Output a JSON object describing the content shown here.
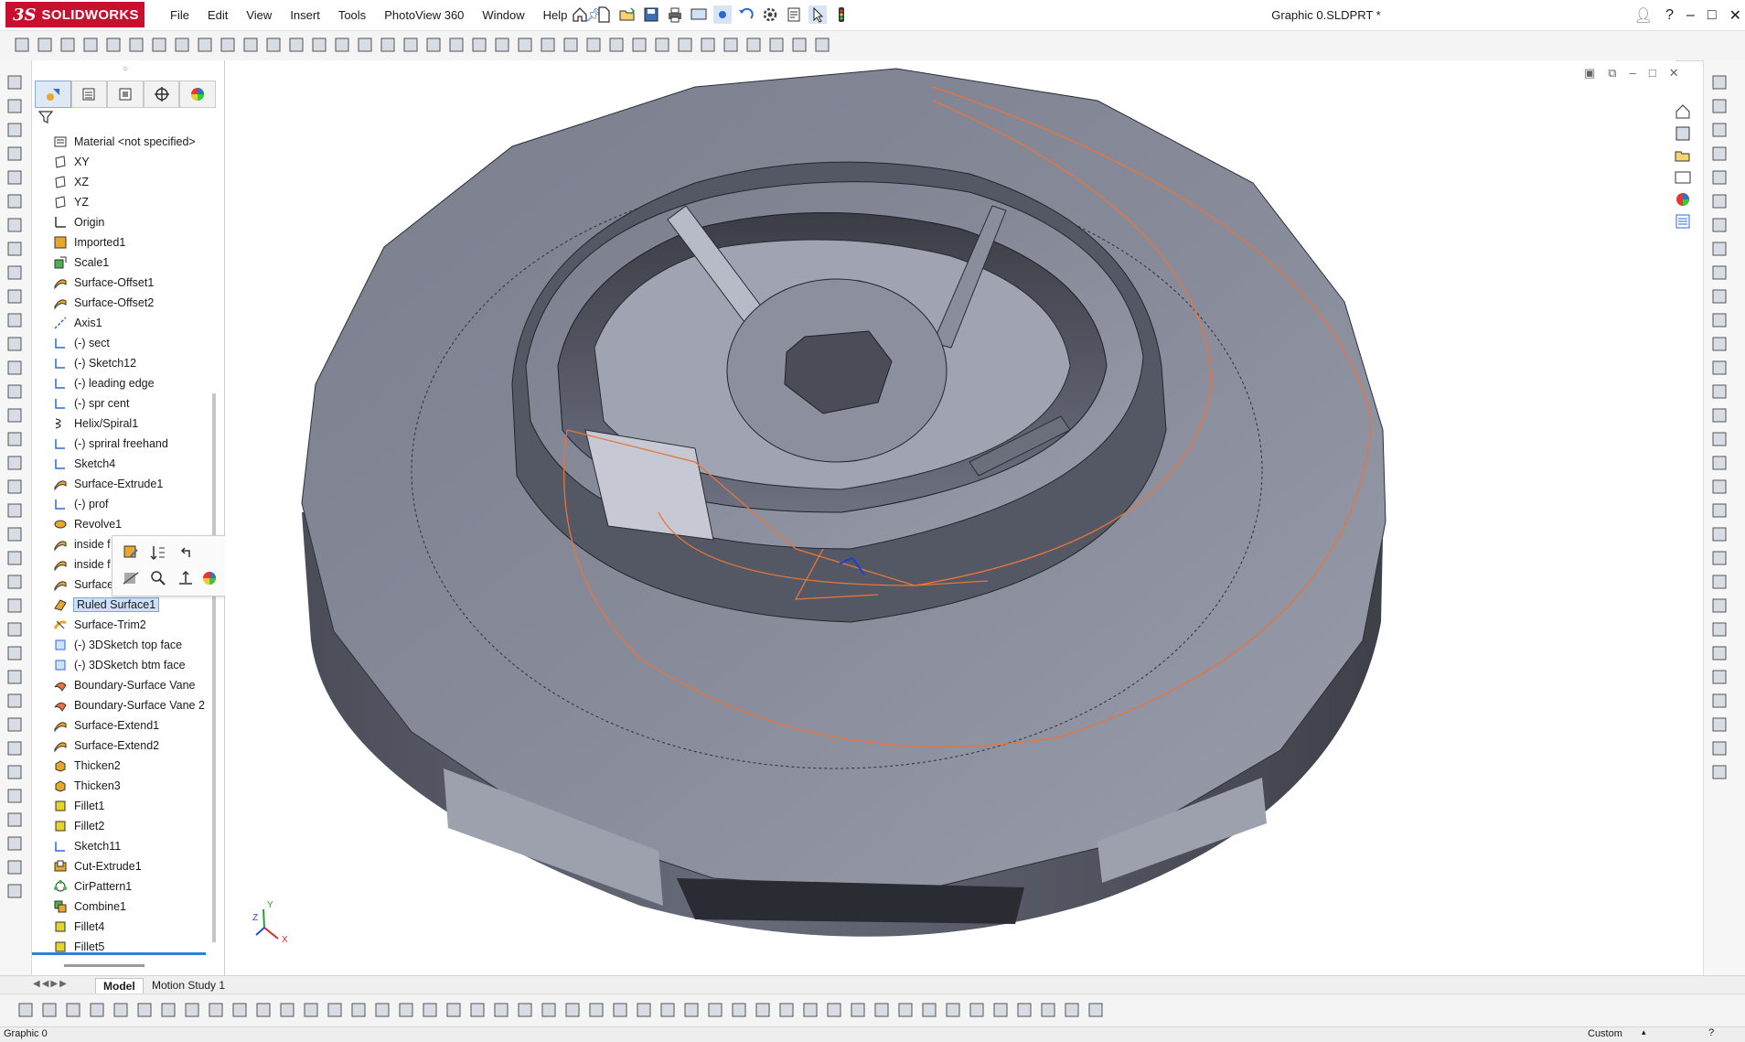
{
  "app": {
    "logo_mark": "3S",
    "logo_name": "SOLIDWORKS",
    "doc_title": "Graphic 0.SLDPRT *"
  },
  "menus": [
    "File",
    "Edit",
    "View",
    "Insert",
    "Tools",
    "PhotoView 360",
    "Window",
    "Help"
  ],
  "feature_tree": {
    "items": [
      {
        "label": "Material <not specified>",
        "icon": "material-icon"
      },
      {
        "label": "XY",
        "icon": "plane-icon"
      },
      {
        "label": "XZ",
        "icon": "plane-icon"
      },
      {
        "label": "YZ",
        "icon": "plane-icon"
      },
      {
        "label": "Origin",
        "icon": "origin-icon"
      },
      {
        "label": "Imported1",
        "icon": "imported-body-icon"
      },
      {
        "label": "Scale1",
        "icon": "scale-icon"
      },
      {
        "label": "Surface-Offset1",
        "icon": "surface-icon"
      },
      {
        "label": "Surface-Offset2",
        "icon": "surface-icon"
      },
      {
        "label": "Axis1",
        "icon": "axis-icon"
      },
      {
        "label": "(-) sect",
        "icon": "sketch-icon"
      },
      {
        "label": "(-) Sketch12",
        "icon": "sketch-icon"
      },
      {
        "label": "(-) leading edge",
        "icon": "sketch-icon"
      },
      {
        "label": "(-) spr cent",
        "icon": "sketch-icon"
      },
      {
        "label": "Helix/Spiral1",
        "icon": "helix-icon"
      },
      {
        "label": "(-) spriral freehand",
        "icon": "sketch-icon"
      },
      {
        "label": "Sketch4",
        "icon": "sketch-icon"
      },
      {
        "label": "Surface-Extrude1",
        "icon": "surface-icon"
      },
      {
        "label": "(-) prof",
        "icon": "sketch-icon"
      },
      {
        "label": "Revolve1",
        "icon": "revolve-icon"
      },
      {
        "label": "inside f",
        "icon": "surface-icon"
      },
      {
        "label": "inside f",
        "icon": "surface-icon"
      },
      {
        "label": "Surface",
        "icon": "surface-icon"
      },
      {
        "label": "Ruled Surface1",
        "icon": "ruled-surface-icon"
      },
      {
        "label": "Surface-Trim2",
        "icon": "surface-trim-icon"
      },
      {
        "label": "(-) 3DSketch top face",
        "icon": "sketch3d-icon"
      },
      {
        "label": "(-) 3DSketch btm face",
        "icon": "sketch3d-icon"
      },
      {
        "label": "Boundary-Surface Vane",
        "icon": "boundary-surface-icon"
      },
      {
        "label": "Boundary-Surface Vane 2",
        "icon": "boundary-surface-icon"
      },
      {
        "label": "Surface-Extend1",
        "icon": "surface-icon"
      },
      {
        "label": "Surface-Extend2",
        "icon": "surface-icon"
      },
      {
        "label": "Thicken2",
        "icon": "solid-feature-icon"
      },
      {
        "label": "Thicken3",
        "icon": "solid-feature-icon"
      },
      {
        "label": "Fillet1",
        "icon": "fillet-icon"
      },
      {
        "label": "Fillet2",
        "icon": "fillet-icon"
      },
      {
        "label": "Sketch11",
        "icon": "sketch-icon"
      },
      {
        "label": "Cut-Extrude1",
        "icon": "cut-extrude-icon"
      },
      {
        "label": "CirPattern1",
        "icon": "circular-pattern-icon"
      },
      {
        "label": "Combine1",
        "icon": "combine-icon"
      },
      {
        "label": "Fillet4",
        "icon": "fillet-icon"
      },
      {
        "label": "Fillet5",
        "icon": "fillet-icon"
      }
    ],
    "selected_index": 23
  },
  "bottom_tabs": [
    "Model",
    "Motion Study 1"
  ],
  "status": {
    "left": "Graphic 0",
    "right": "Custom"
  },
  "axis_triad": {
    "x": "X",
    "y": "Y",
    "z": "Z"
  },
  "colors": {
    "accent": "#c8102e",
    "selection": "#cde0f7",
    "sketch_curve": "#e8743b",
    "model": "#8a8d9a"
  }
}
